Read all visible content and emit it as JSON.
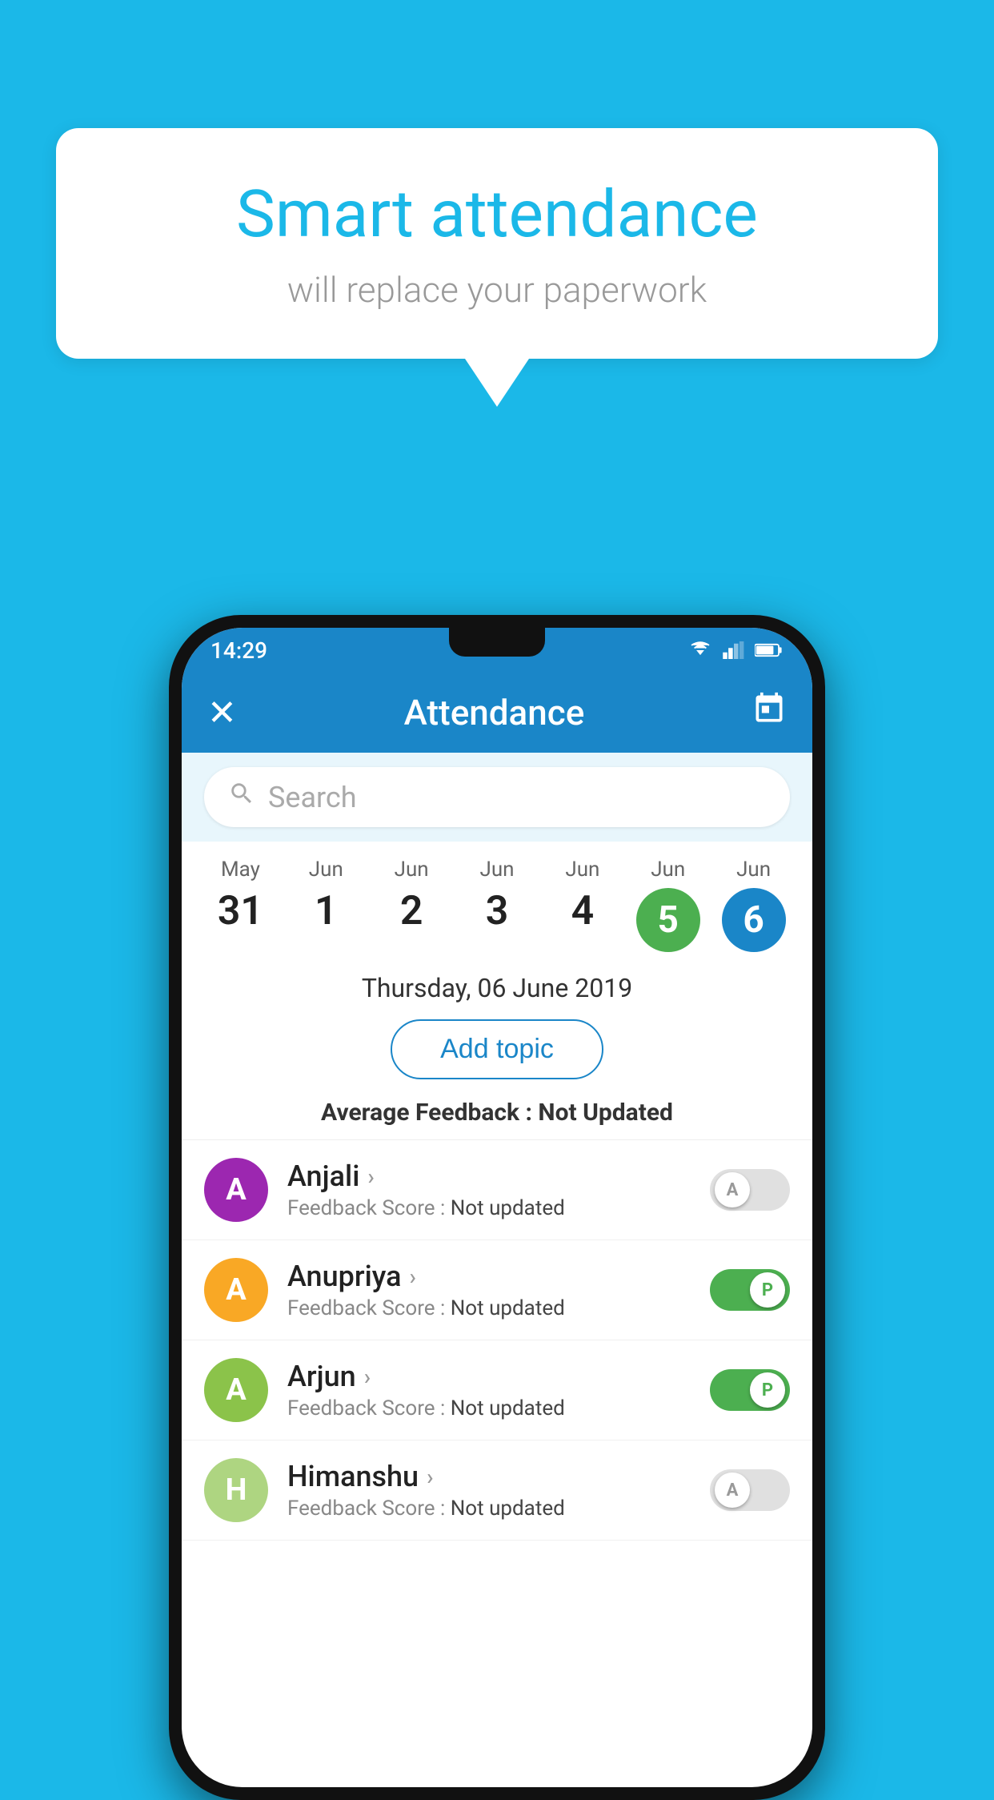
{
  "page": {
    "bg_color": "#1bb8e8"
  },
  "bubble": {
    "title": "Smart attendance",
    "subtitle": "will replace your paperwork"
  },
  "statusbar": {
    "time": "14:29"
  },
  "appbar": {
    "title": "Attendance",
    "close_label": "✕",
    "calendar_label": "📅"
  },
  "search": {
    "placeholder": "Search"
  },
  "dates": [
    {
      "month": "May",
      "day": "31",
      "type": "plain"
    },
    {
      "month": "Jun",
      "day": "1",
      "type": "plain"
    },
    {
      "month": "Jun",
      "day": "2",
      "type": "plain"
    },
    {
      "month": "Jun",
      "day": "3",
      "type": "plain"
    },
    {
      "month": "Jun",
      "day": "4",
      "type": "plain"
    },
    {
      "month": "Jun",
      "day": "5",
      "type": "green"
    },
    {
      "month": "Jun",
      "day": "6",
      "type": "blue"
    }
  ],
  "selected_date": "Thursday, 06 June 2019",
  "add_topic_label": "Add topic",
  "avg_feedback_label": "Average Feedback : ",
  "avg_feedback_value": "Not Updated",
  "students": [
    {
      "name": "Anjali",
      "initial": "A",
      "avatar_color": "#9c27b0",
      "score_label": "Feedback Score : ",
      "score_value": "Not updated",
      "toggle_state": "off",
      "toggle_letter": "A"
    },
    {
      "name": "Anupriya",
      "initial": "A",
      "avatar_color": "#f9a825",
      "score_label": "Feedback Score : ",
      "score_value": "Not updated",
      "toggle_state": "on",
      "toggle_letter": "P"
    },
    {
      "name": "Arjun",
      "initial": "A",
      "avatar_color": "#8bc34a",
      "score_label": "Feedback Score : ",
      "score_value": "Not updated",
      "toggle_state": "on",
      "toggle_letter": "P"
    },
    {
      "name": "Himanshu",
      "initial": "H",
      "avatar_color": "#aed581",
      "score_label": "Feedback Score : ",
      "score_value": "Not updated",
      "toggle_state": "off",
      "toggle_letter": "A"
    }
  ]
}
